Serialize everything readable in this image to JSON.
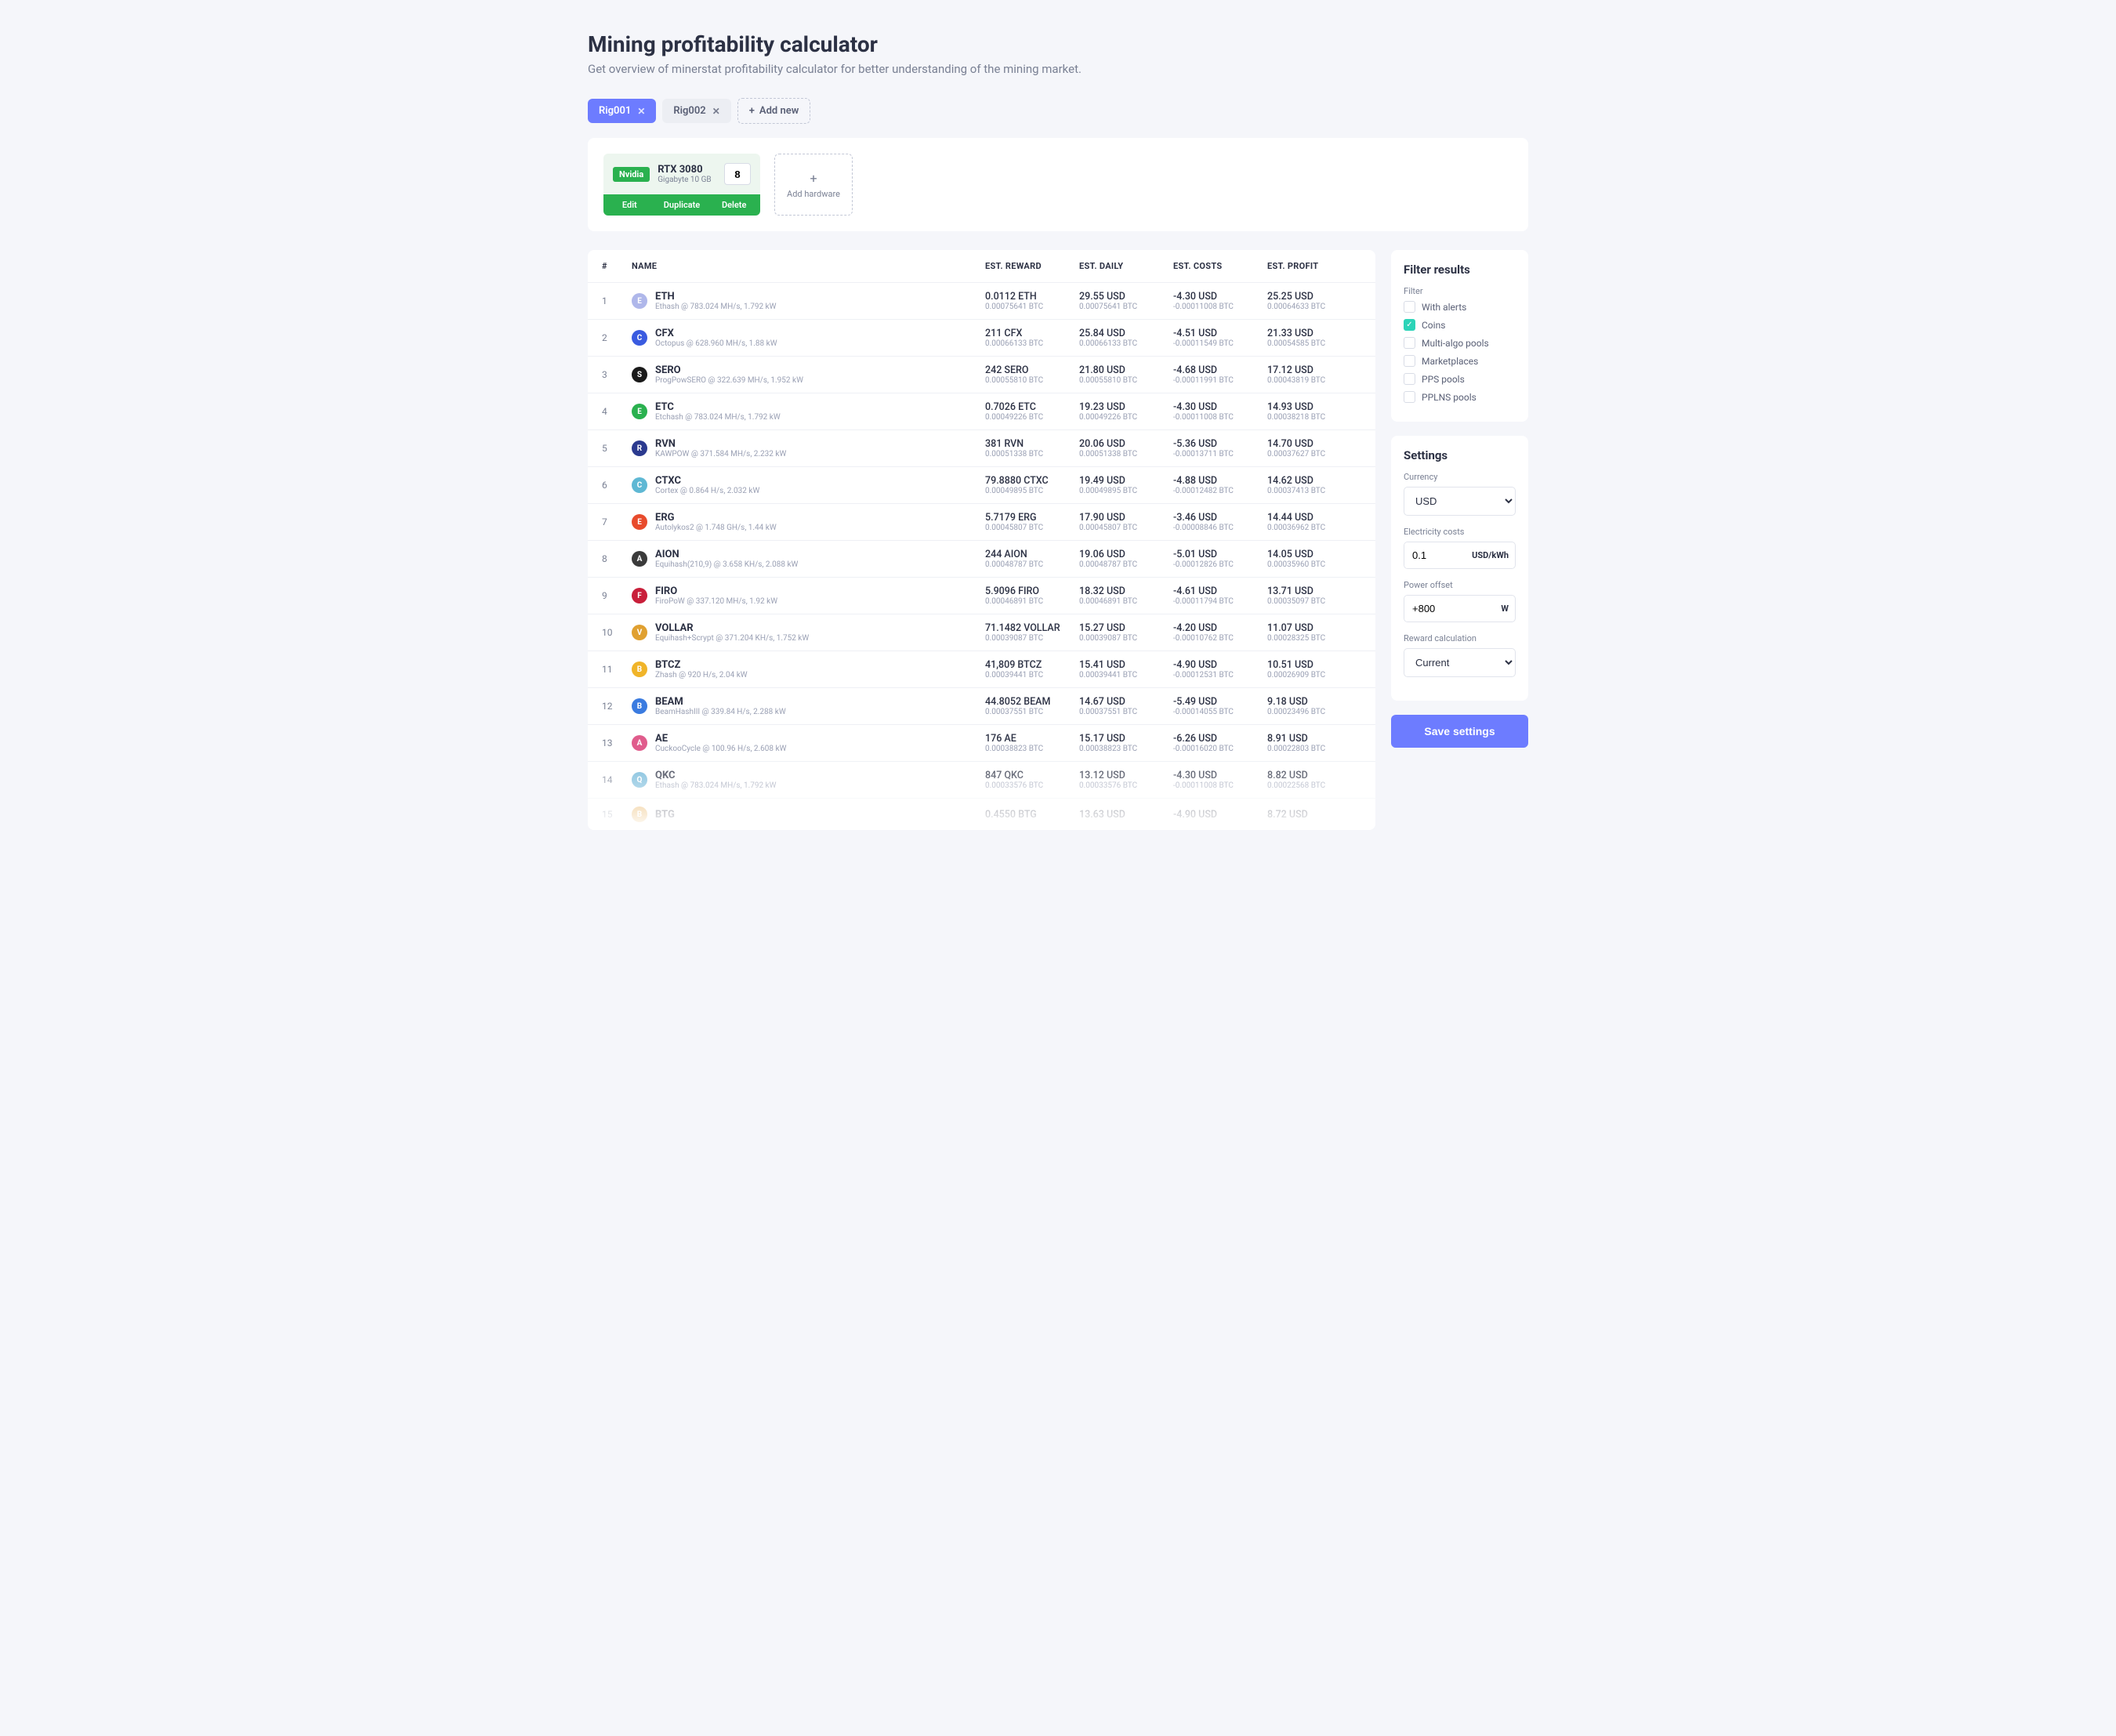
{
  "header": {
    "title": "Mining profitability calculator",
    "subtitle": "Get overview of minerstat profitability calculator for better understanding of the mining market."
  },
  "tabs": [
    {
      "label": "Rig001",
      "active": true
    },
    {
      "label": "Rig002",
      "active": false
    }
  ],
  "add_tab_label": "Add new",
  "hardware": {
    "badge": "Nvidia",
    "name": "RTX 3080",
    "sub": "Gigabyte 10 GB",
    "count": "8",
    "actions": {
      "edit": "Edit",
      "duplicate": "Duplicate",
      "delete": "Delete"
    },
    "add_label": "Add hardware"
  },
  "table": {
    "headers": {
      "idx": "#",
      "name": "NAME",
      "reward": "EST. REWARD",
      "daily": "EST. DAILY",
      "costs": "EST. COSTS",
      "profit": "EST. PROFIT"
    },
    "rows": [
      {
        "idx": "1",
        "sym": "ETH",
        "algo": "Ethash @ 783.024 MH/s, 1.792 kW",
        "reward": "0.0112 ETH",
        "reward_btc": "0.00075641 BTC",
        "daily": "29.55 USD",
        "daily_btc": "0.00075641 BTC",
        "costs": "-4.30 USD",
        "costs_btc": "-0.00011008 BTC",
        "profit": "25.25 USD",
        "profit_btc": "0.00064633 BTC",
        "color": "#afb7ea"
      },
      {
        "idx": "2",
        "sym": "CFX",
        "algo": "Octopus @ 628.960 MH/s, 1.88 kW",
        "reward": "211 CFX",
        "reward_btc": "0.00066133 BTC",
        "daily": "25.84 USD",
        "daily_btc": "0.00066133 BTC",
        "costs": "-4.51 USD",
        "costs_btc": "-0.00011549 BTC",
        "profit": "21.33 USD",
        "profit_btc": "0.00054585 BTC",
        "color": "#3a5be0"
      },
      {
        "idx": "3",
        "sym": "SERO",
        "algo": "ProgPowSERO @ 322.639 MH/s, 1.952 kW",
        "reward": "242 SERO",
        "reward_btc": "0.00055810 BTC",
        "daily": "21.80 USD",
        "daily_btc": "0.00055810 BTC",
        "costs": "-4.68 USD",
        "costs_btc": "-0.00011991 BTC",
        "profit": "17.12 USD",
        "profit_btc": "0.00043819 BTC",
        "color": "#1a1a1a"
      },
      {
        "idx": "4",
        "sym": "ETC",
        "algo": "Etchash @ 783.024 MH/s, 1.792 kW",
        "reward": "0.7026 ETC",
        "reward_btc": "0.00049226 BTC",
        "daily": "19.23 USD",
        "daily_btc": "0.00049226 BTC",
        "costs": "-4.30 USD",
        "costs_btc": "-0.00011008 BTC",
        "profit": "14.93 USD",
        "profit_btc": "0.00038218 BTC",
        "color": "#2ab14f"
      },
      {
        "idx": "5",
        "sym": "RVN",
        "algo": "KAWPOW @ 371.584 MH/s, 2.232 kW",
        "reward": "381 RVN",
        "reward_btc": "0.00051338 BTC",
        "daily": "20.06 USD",
        "daily_btc": "0.00051338 BTC",
        "costs": "-5.36 USD",
        "costs_btc": "-0.00013711 BTC",
        "profit": "14.70 USD",
        "profit_btc": "0.00037627 BTC",
        "color": "#2b3a8f"
      },
      {
        "idx": "6",
        "sym": "CTXC",
        "algo": "Cortex @ 0.864 H/s, 2.032 kW",
        "reward": "79.8880 CTXC",
        "reward_btc": "0.00049895 BTC",
        "daily": "19.49 USD",
        "daily_btc": "0.00049895 BTC",
        "costs": "-4.88 USD",
        "costs_btc": "-0.00012482 BTC",
        "profit": "14.62 USD",
        "profit_btc": "0.00037413 BTC",
        "color": "#5fb8d4"
      },
      {
        "idx": "7",
        "sym": "ERG",
        "algo": "Autolykos2 @ 1.748 GH/s, 1.44 kW",
        "reward": "5.7179 ERG",
        "reward_btc": "0.00045807 BTC",
        "daily": "17.90 USD",
        "daily_btc": "0.00045807 BTC",
        "costs": "-3.46 USD",
        "costs_btc": "-0.00008846 BTC",
        "profit": "14.44 USD",
        "profit_btc": "0.00036962 BTC",
        "color": "#e84b2c"
      },
      {
        "idx": "8",
        "sym": "AION",
        "algo": "Equihash(210,9) @ 3.658 KH/s, 2.088 kW",
        "reward": "244 AION",
        "reward_btc": "0.00048787 BTC",
        "daily": "19.06 USD",
        "daily_btc": "0.00048787 BTC",
        "costs": "-5.01 USD",
        "costs_btc": "-0.00012826 BTC",
        "profit": "14.05 USD",
        "profit_btc": "0.00035960 BTC",
        "color": "#3a3a3a"
      },
      {
        "idx": "9",
        "sym": "FIRO",
        "algo": "FiroPoW @ 337.120 MH/s, 1.92 kW",
        "reward": "5.9096 FIRO",
        "reward_btc": "0.00046891 BTC",
        "daily": "18.32 USD",
        "daily_btc": "0.00046891 BTC",
        "costs": "-4.61 USD",
        "costs_btc": "-0.00011794 BTC",
        "profit": "13.71 USD",
        "profit_btc": "0.00035097 BTC",
        "color": "#c91f3a"
      },
      {
        "idx": "10",
        "sym": "VOLLAR",
        "algo": "Equihash+Scrypt @ 371.204 KH/s, 1.752 kW",
        "reward": "71.1482 VOLLAR",
        "reward_btc": "0.00039087 BTC",
        "daily": "15.27 USD",
        "daily_btc": "0.00039087 BTC",
        "costs": "-4.20 USD",
        "costs_btc": "-0.00010762 BTC",
        "profit": "11.07 USD",
        "profit_btc": "0.00028325 BTC",
        "color": "#e0a030"
      },
      {
        "idx": "11",
        "sym": "BTCZ",
        "algo": "Zhash @ 920 H/s, 2.04 kW",
        "reward": "41,809 BTCZ",
        "reward_btc": "0.00039441 BTC",
        "daily": "15.41 USD",
        "daily_btc": "0.00039441 BTC",
        "costs": "-4.90 USD",
        "costs_btc": "-0.00012531 BTC",
        "profit": "10.51 USD",
        "profit_btc": "0.00026909 BTC",
        "color": "#f0b429"
      },
      {
        "idx": "12",
        "sym": "BEAM",
        "algo": "BeamHashIII @ 339.84 H/s, 2.288 kW",
        "reward": "44.8052 BEAM",
        "reward_btc": "0.00037551 BTC",
        "daily": "14.67 USD",
        "daily_btc": "0.00037551 BTC",
        "costs": "-5.49 USD",
        "costs_btc": "-0.00014055 BTC",
        "profit": "9.18 USD",
        "profit_btc": "0.00023496 BTC",
        "color": "#3a7be0"
      },
      {
        "idx": "13",
        "sym": "AE",
        "algo": "CuckooCycle @ 100.96 H/s, 2.608 kW",
        "reward": "176 AE",
        "reward_btc": "0.00038823 BTC",
        "daily": "15.17 USD",
        "daily_btc": "0.00038823 BTC",
        "costs": "-6.26 USD",
        "costs_btc": "-0.00016020 BTC",
        "profit": "8.91 USD",
        "profit_btc": "0.00022803 BTC",
        "color": "#e05c8c"
      },
      {
        "idx": "14",
        "sym": "QKC",
        "algo": "Ethash @ 783.024 MH/s, 1.792 kW",
        "reward": "847 QKC",
        "reward_btc": "0.00033576 BTC",
        "daily": "13.12 USD",
        "daily_btc": "0.00033576 BTC",
        "costs": "-4.30 USD",
        "costs_btc": "-0.00011008 BTC",
        "profit": "8.82 USD",
        "profit_btc": "0.00022568 BTC",
        "color": "#6db5d8"
      },
      {
        "idx": "15",
        "sym": "BTG",
        "algo": "",
        "reward": "0.4550 BTG",
        "reward_btc": "",
        "daily": "13.63 USD",
        "daily_btc": "",
        "costs": "-4.90 USD",
        "costs_btc": "",
        "profit": "8.72 USD",
        "profit_btc": "",
        "color": "#e29b2e"
      }
    ]
  },
  "filter": {
    "title": "Filter results",
    "label": "Filter",
    "options": [
      {
        "label": "With alerts",
        "checked": false
      },
      {
        "label": "Coins",
        "checked": true
      },
      {
        "label": "Multi-algo pools",
        "checked": false
      },
      {
        "label": "Marketplaces",
        "checked": false
      },
      {
        "label": "PPS pools",
        "checked": false
      },
      {
        "label": "PPLNS pools",
        "checked": false
      }
    ]
  },
  "settings": {
    "title": "Settings",
    "currency_label": "Currency",
    "currency_value": "USD",
    "electricity_label": "Electricity costs",
    "electricity_value": "0.1",
    "electricity_unit": "USD/kWh",
    "power_label": "Power offset",
    "power_value": "+800",
    "power_unit": "W",
    "reward_label": "Reward calculation",
    "reward_value": "Current",
    "save_label": "Save settings"
  }
}
